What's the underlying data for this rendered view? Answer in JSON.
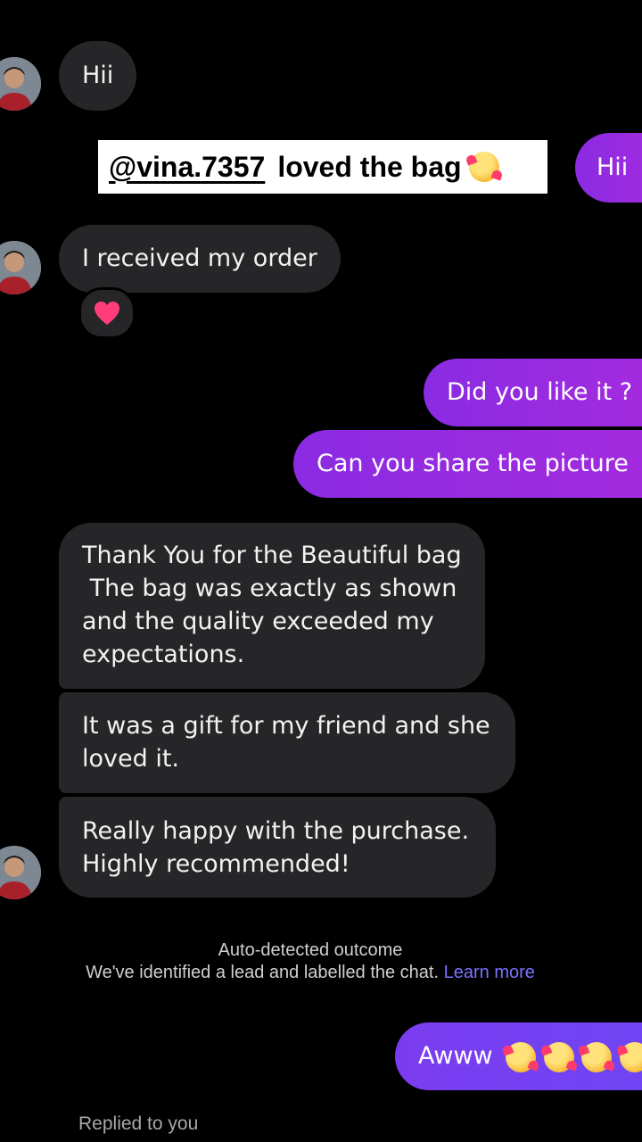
{
  "messages": {
    "m1": "Hii",
    "m2": "Hii",
    "m3": "I received my order",
    "m4": "Did you like it ?",
    "m5": "Can you share the picture",
    "m6_l1": "Thank You for the Beautiful bag",
    "m6_l2": " The bag was exactly as shown",
    "m6_l3": "and the quality exceeded my",
    "m6_l4": "expectations.",
    "m7_l1": "It was a gift for my friend and she",
    "m7_l2": "loved it.",
    "m8_l1": "Really happy with the purchase.",
    "m8_l2": "Highly recommended!",
    "m9": "Awww"
  },
  "sticker": {
    "handle": "@vina.7357",
    "text": "loved the bag"
  },
  "reaction_icon": "heart-icon",
  "system": {
    "title": "Auto-detected outcome",
    "body": "We've identified a lead and labelled the chat.",
    "link": "Learn more"
  },
  "footer": {
    "replied": "Replied to you"
  },
  "colors": {
    "incoming_bubble": "#262629",
    "outgoing_bubble": "#9a2ee0",
    "outgoing_violet": "#7540f2",
    "link": "#7a72ff"
  }
}
